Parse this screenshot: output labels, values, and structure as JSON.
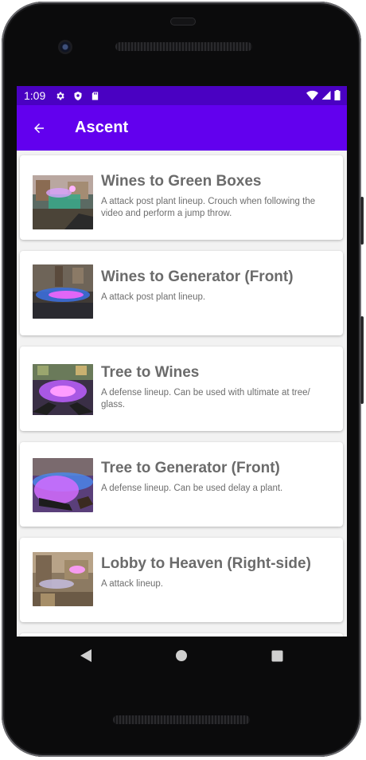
{
  "status_bar": {
    "time": "1:09",
    "icons": [
      "gear-icon",
      "shield-icon",
      "sd-card-icon"
    ],
    "right_icons": [
      "wifi-icon",
      "cell-signal-icon",
      "battery-icon"
    ]
  },
  "app_bar": {
    "title": "Ascent",
    "back_icon": "arrow-back-icon",
    "color": "#6200ee",
    "status_color": "#4a01c2"
  },
  "lineups": [
    {
      "title": "Wines to Green Boxes",
      "description": "A attack post plant lineup. Crouch when following the video and perform a jump throw."
    },
    {
      "title": "Wines to Generator (Front)",
      "description": "A attack post plant lineup."
    },
    {
      "title": "Tree to Wines",
      "description": "A defense lineup. Can be used with ultimate at tree/ glass."
    },
    {
      "title": "Tree to Generator (Front)",
      "description": "A defense lineup. Can be used delay a plant."
    },
    {
      "title": "Lobby to Heaven (Right-side)",
      "description": "A attack lineup."
    }
  ],
  "nav_bar": {
    "icons": [
      "back-triangle-icon",
      "home-circle-icon",
      "recents-square-icon"
    ]
  }
}
